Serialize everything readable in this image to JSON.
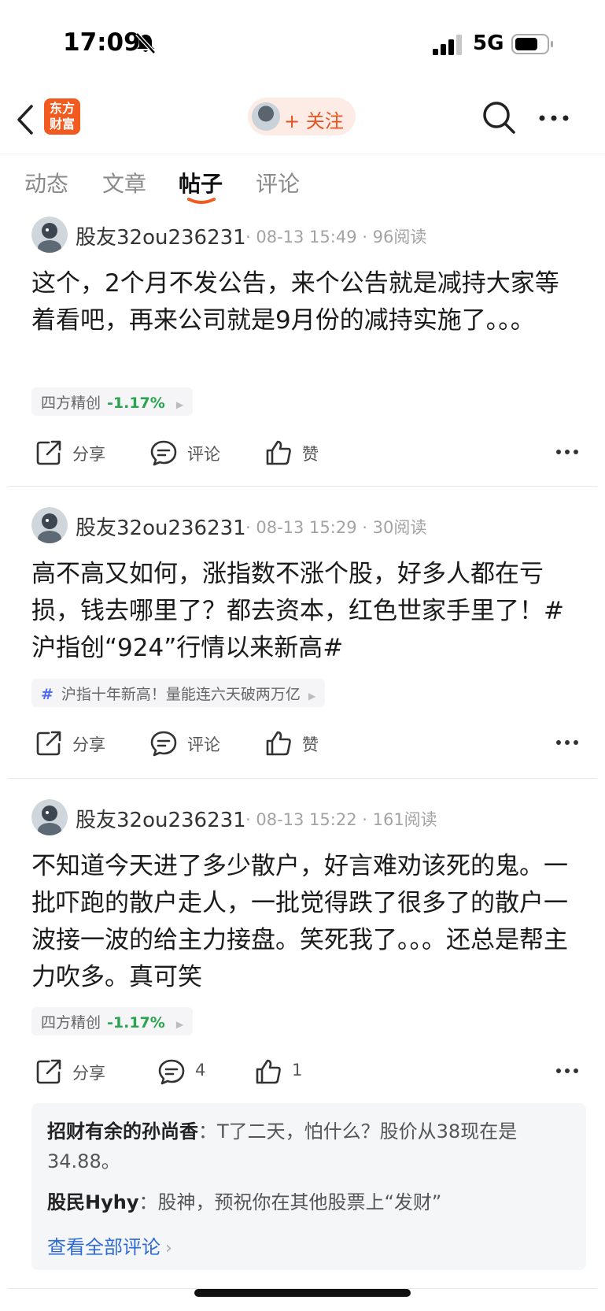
{
  "status_bar": {
    "time": "17:09",
    "network": "5G"
  },
  "nav": {
    "logo_line1": "东方",
    "logo_line2": "财富",
    "follow_label": "+ 关注"
  },
  "tabs": [
    {
      "label": "动态"
    },
    {
      "label": "文章"
    },
    {
      "label": "帖子",
      "active": true
    },
    {
      "label": "评论"
    }
  ],
  "posts": [
    {
      "author": "股友32ou236231",
      "meta": "· 08-13 15:49 · 96阅读",
      "body": "这个，2个月不发公告，来个公告就是减持大家等着看吧，再来公司就是9月份的减持实施了。。。",
      "stock_name": "四方精创",
      "stock_change": "-1.17%",
      "share": "分享",
      "comment": "评论",
      "like": "赞"
    },
    {
      "author": "股友32ou236231",
      "meta": "· 08-13 15:29 · 30阅读",
      "body": "高不高又如何，涨指数不涨个股，好多人都在亏损，钱去哪里了？都去资本，红色世家手里了！#沪指创“924”行情以来新高#",
      "topic": "沪指十年新高！量能连六天破两万亿",
      "share": "分享",
      "comment": "评论",
      "like": "赞"
    },
    {
      "author": "股友32ou236231",
      "meta": "· 08-13 15:22 · 161阅读",
      "body": "不知道今天进了多少散户，好言难劝该死的鬼。一批吓跑的散户走人，一批觉得跌了很多了的散户一波接一波的给主力接盘。笑死我了。。。还总是帮主力吹多。真可笑",
      "stock_name": "四方精创",
      "stock_change": "-1.17%",
      "share": "分享",
      "comment": "4",
      "like": "1",
      "comments": [
        {
          "author": "招财有余的孙尚香",
          "text": "T了二天，怕什么？股价从38现在是34.88。"
        },
        {
          "author": "股民Hyhy",
          "text": "股神，预祝你在其他股票上“发财”"
        }
      ],
      "view_all": "查看全部评论"
    }
  ],
  "colors": {
    "accent": "#e8521e",
    "stock_down": "#2aa44f",
    "link": "#2f6bd6"
  }
}
